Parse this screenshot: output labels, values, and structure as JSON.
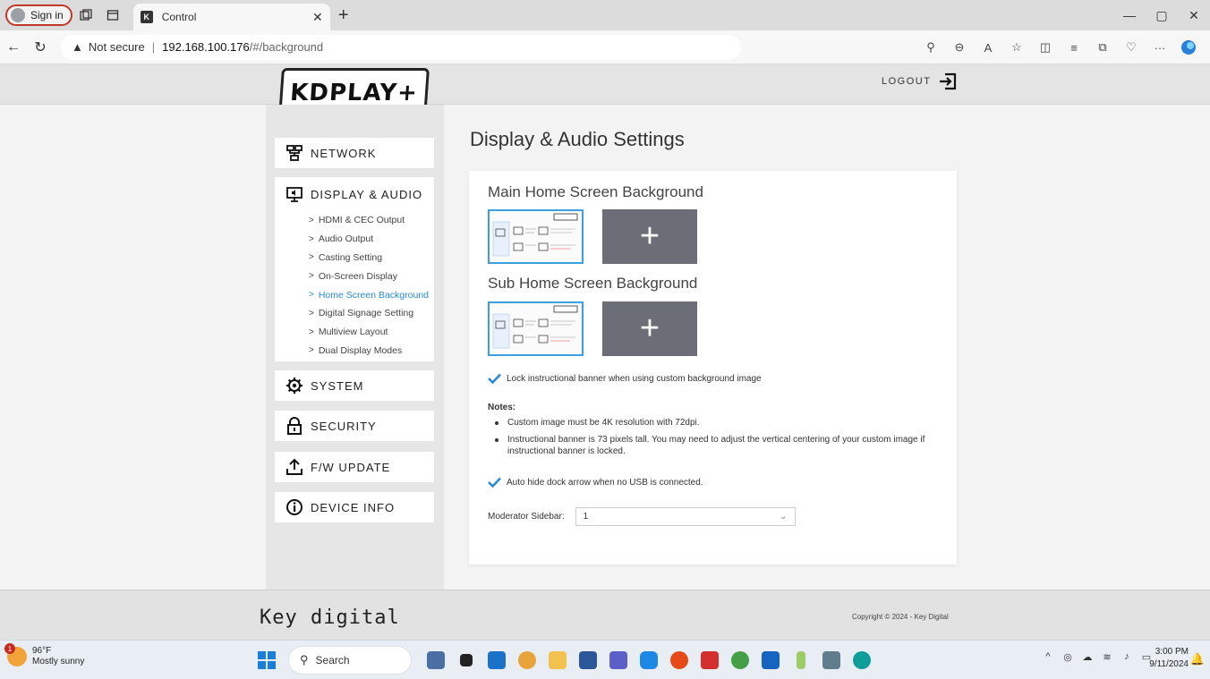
{
  "browser": {
    "sign_in": "Sign in",
    "tab_title": "Control",
    "tab_favicon": "K",
    "url_warning": "Not secure",
    "url_host": "192.168.100.176",
    "url_path": "/#/background"
  },
  "header": {
    "logo_text": "KDPLAY+",
    "logout_label": "LOGOUT"
  },
  "sidebar": {
    "network": "NETWORK",
    "display_audio": "DISPLAY & AUDIO",
    "submenu": [
      {
        "label": "HDMI & CEC Output"
      },
      {
        "label": "Audio Output"
      },
      {
        "label": "Casting Setting"
      },
      {
        "label": "On-Screen Display"
      },
      {
        "label": "Home Screen Background"
      },
      {
        "label": "Digital Signage Setting"
      },
      {
        "label": "Multiview Layout"
      },
      {
        "label": "Dual Display Modes"
      }
    ],
    "system": "SYSTEM",
    "security": "SECURITY",
    "fw_update": "F/W UPDATE",
    "device_info": "DEVICE INFO"
  },
  "main": {
    "title": "Display & Audio Settings",
    "main_bg_title": "Main Home Screen Background",
    "sub_bg_title": "Sub Home Screen Background",
    "lock_banner_label": "Lock instructional banner when using custom background image",
    "notes_title": "Notes:",
    "notes": [
      "Custom image must be 4K resolution with 72dpi.",
      "Instructional banner is 73 pixels tall. You may need to adjust the vertical centering of your custom image if instructional banner is locked."
    ],
    "auto_hide_label": "Auto hide dock arrow when no USB is connected.",
    "moderator_label": "Moderator Sidebar:",
    "moderator_value": "1"
  },
  "footer": {
    "brand": "Key digital",
    "copyright": "Copyright © 2024 - Key Digital"
  },
  "taskbar": {
    "weather_badge": "1",
    "temperature": "96°F",
    "condition": "Mostly sunny",
    "search_label": "Search",
    "time": "3:00 PM",
    "date": "9/11/2024"
  },
  "colors": {
    "accent": "#2a8bd8",
    "add_tile": "#6b6e76",
    "check": "#2a8bd8"
  }
}
